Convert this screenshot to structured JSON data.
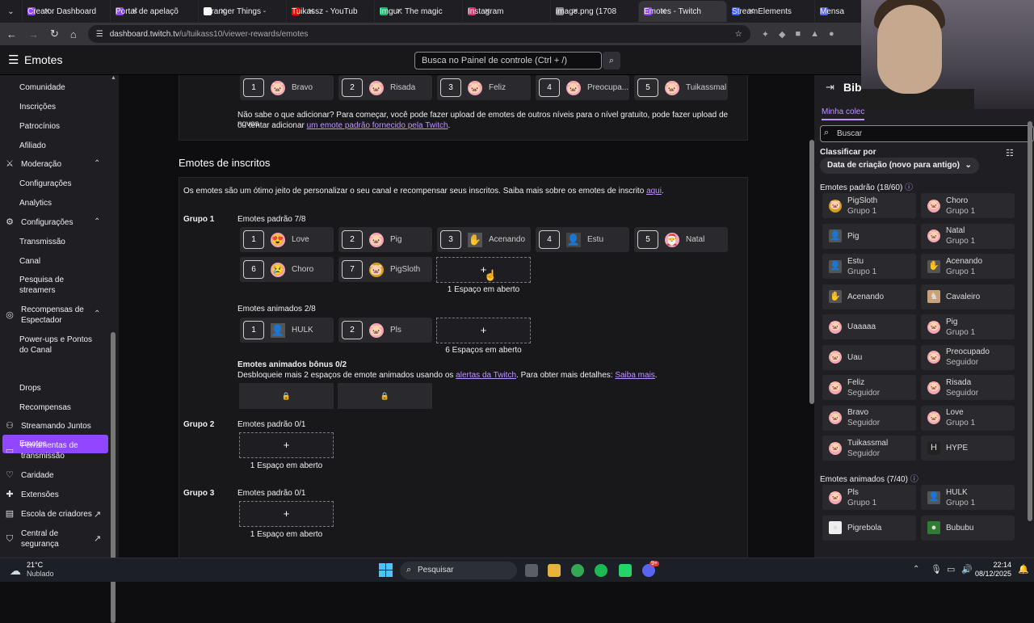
{
  "browser": {
    "tabs": [
      {
        "label": "Creator Dashboard",
        "color": "#9147ff"
      },
      {
        "label": "Portal de apelaçõ",
        "color": "#9147ff"
      },
      {
        "label": "Stranger Things -",
        "color": "#ffffff"
      },
      {
        "label": "Tuikassz - YouTub",
        "color": "#ff0000"
      },
      {
        "label": "Imgur: The magic",
        "color": "#1bb76e"
      },
      {
        "label": "Instagram",
        "color": "#e1306c"
      },
      {
        "label": "image.png (1708",
        "color": "#888888"
      },
      {
        "label": "Emotes - Twitch",
        "color": "#9147ff"
      },
      {
        "label": "StreamElements",
        "color": "#3d5afe"
      },
      {
        "label": "Mensa",
        "color": "#5865f2"
      }
    ],
    "url_host": "dashboard.twitch.tv",
    "url_path": "/u/tuikass10/viewer-rewards/emotes"
  },
  "header": {
    "title": "Emotes",
    "search_placeholder": "Busca no Painel de controle (Ctrl + /)"
  },
  "sidebar": {
    "items": [
      "Comunidade",
      "Inscrições",
      "Patrocínios",
      "Afiliado",
      "Moderação",
      "Configurações",
      "Analytics",
      "Configurações",
      "Transmissão",
      "Canal",
      "Pesquisa de streamers",
      "Recompensas de Espectador",
      "Power-ups e Pontos do Canal",
      "Emotes",
      "Drops",
      "Recompensas",
      "Streamando Juntos",
      "Ferramentas de transmissão",
      "Caridade",
      "Extensões",
      "Escola de criadores",
      "Central de segurança"
    ]
  },
  "follower": {
    "slots": [
      {
        "n": "1",
        "name": "Bravo"
      },
      {
        "n": "2",
        "name": "Risada"
      },
      {
        "n": "3",
        "name": "Feliz"
      },
      {
        "n": "4",
        "name": "Preocupa..."
      },
      {
        "n": "5",
        "name": "Tuikassmal"
      }
    ],
    "help1": "Não sabe o que adicionar? Para começar, você pode fazer upload de emotes de outros níveis para o nível gratuito, pode fazer upload de novos",
    "help2": "ou tentar adicionar",
    "help_link": "um emote padrão fornecido pela Twitch",
    "help_end": "."
  },
  "sub": {
    "heading": "Emotes de inscritos",
    "intro": "Os emotes são um ótimo jeito de personalizar o seu canal e recompensar seus inscritos. Saiba mais sobre os emotes de inscrito",
    "intro_link": "aqui",
    "intro_end": ".",
    "group1": "Grupo 1",
    "std_label": "Emotes padrão 7/8",
    "std": [
      {
        "n": "1",
        "name": "Love"
      },
      {
        "n": "2",
        "name": "Pig"
      },
      {
        "n": "3",
        "name": "Acenando"
      },
      {
        "n": "4",
        "name": "Estu"
      },
      {
        "n": "5",
        "name": "Natal"
      },
      {
        "n": "6",
        "name": "Choro"
      },
      {
        "n": "7",
        "name": "PigSloth"
      }
    ],
    "add": "+",
    "std_open": "1 Espaço em aberto",
    "anim_label": "Emotes animados 2/8",
    "anim": [
      {
        "n": "1",
        "name": "HULK"
      },
      {
        "n": "2",
        "name": "Pls"
      }
    ],
    "anim_open": "6 Espaços em aberto",
    "bonus_label": "Emotes animados bônus 0/2",
    "bonus_text": "Desbloqueie mais 2 espaços de emote animados usando os",
    "bonus_link1": "alertas da Twitch",
    "bonus_mid": ". Para obter mais detalhes:",
    "bonus_link2": "Saiba mais",
    "bonus_end": ".",
    "lock": "🔒",
    "group2": "Grupo 2",
    "group2_label": "Emotes padrão 0/1",
    "group2_open": "1 Espaço em aberto",
    "group3": "Grupo 3",
    "group3_label": "Emotes padrão 0/1",
    "group3_open": "1 Espaço em aberto"
  },
  "library": {
    "title": "Bibli",
    "tab": "Minha colec",
    "search_placeholder": "Buscar",
    "sort_label": "Classificar por",
    "sort_value": "Data de criação (novo para antigo)",
    "std_title": "Emotes padrão (18/60)",
    "std": [
      {
        "name": "PigSloth",
        "sub": "Grupo 1"
      },
      {
        "name": "Choro",
        "sub": "Grupo 1"
      },
      {
        "name": "Pig",
        "sub": ""
      },
      {
        "name": "Natal",
        "sub": "Grupo 1"
      },
      {
        "name": "Estu",
        "sub": "Grupo 1"
      },
      {
        "name": "Acenando",
        "sub": "Grupo 1"
      },
      {
        "name": "Acenando",
        "sub": ""
      },
      {
        "name": "Cavaleiro",
        "sub": ""
      },
      {
        "name": "Uaaaaa",
        "sub": ""
      },
      {
        "name": "Pig",
        "sub": "Grupo 1"
      },
      {
        "name": "Uau",
        "sub": ""
      },
      {
        "name": "Preocupado",
        "sub": "Seguidor"
      },
      {
        "name": "Feliz",
        "sub": "Seguidor"
      },
      {
        "name": "Risada",
        "sub": "Seguidor"
      },
      {
        "name": "Bravo",
        "sub": "Seguidor"
      },
      {
        "name": "Love",
        "sub": "Grupo 1"
      },
      {
        "name": "Tuikassmal",
        "sub": "Seguidor"
      },
      {
        "name": "HYPE",
        "sub": ""
      }
    ],
    "anim_title": "Emotes animados (7/40)",
    "anim": [
      {
        "name": "Pls",
        "sub": "Grupo 1"
      },
      {
        "name": "HULK",
        "sub": "Grupo 1"
      },
      {
        "name": "Pigrebola",
        "sub": ""
      },
      {
        "name": "Bububu",
        "sub": ""
      }
    ]
  },
  "taskbar": {
    "temp": "21°C",
    "weather": "Nublado",
    "search": "Pesquisar",
    "time": "22:14",
    "date": "08/12/2025",
    "badge": "9+"
  }
}
